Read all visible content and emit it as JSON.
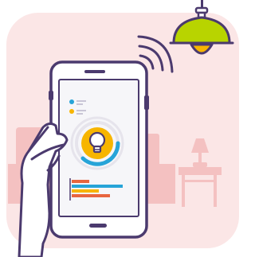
{
  "illustration": {
    "subject": "smartphone-smart-lamp-control",
    "icons": [
      "pendant-lamp-icon",
      "wifi-signal-icon",
      "table-lamp-icon",
      "smartphone-icon",
      "light-bulb-icon",
      "hand-icon"
    ],
    "screen": {
      "legend_items": 2,
      "gauge_level": 0.7,
      "bars": [
        {
          "color": "#e8663f",
          "value": 0.3
        },
        {
          "color": "#27a4d8",
          "value": 0.95
        },
        {
          "color": "#f7b500",
          "value": 0.55
        },
        {
          "color": "#e8663f",
          "value": 0.75
        }
      ]
    }
  },
  "colors": {
    "background_room": "#fbe6e6",
    "furniture": "#f4c1c1",
    "outline": "#4b3a6e",
    "phone_body": "#ffffff",
    "screen": "#f6f6f9",
    "lamp_shade": "#b8d400",
    "lamp_bulb": "#f7b500",
    "gauge_yellow": "#f7b500",
    "gauge_blue": "#27a4d8"
  }
}
